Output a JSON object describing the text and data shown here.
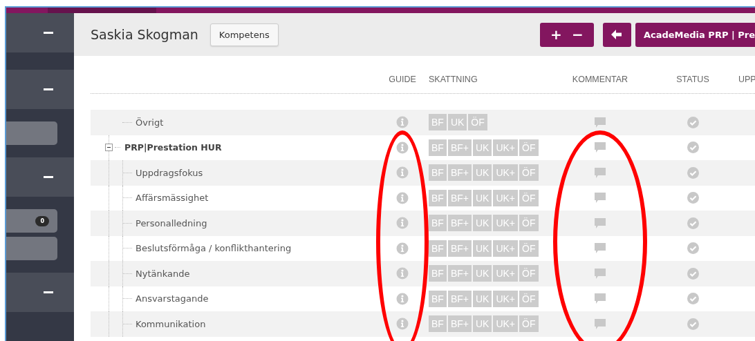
{
  "header": {
    "title": "Saskia Skogman",
    "tab_button": "Kompetens"
  },
  "toolbar": [
    {
      "kind": "group",
      "labels": [
        "+",
        "−"
      ]
    },
    {
      "kind": "back"
    },
    {
      "kind": "menu",
      "label": "AcadeMedia PRP | Pre"
    }
  ],
  "sidebar": {
    "items": [
      {
        "kind": "section"
      },
      {
        "kind": "section"
      },
      {
        "kind": "pills",
        "pills": [
          {
            "kind": "plain"
          }
        ]
      },
      {
        "kind": "section"
      },
      {
        "kind": "pills",
        "pills": [
          {
            "kind": "badge",
            "badge": "0"
          },
          {
            "kind": "plain"
          }
        ]
      },
      {
        "kind": "section"
      }
    ]
  },
  "table": {
    "columns": [
      {
        "label": "GUIDE",
        "circled": true
      },
      {
        "label": "SKATTNING",
        "circled": false
      },
      {
        "label": "KOMMENTAR",
        "circled": true
      },
      {
        "label": "STATUS",
        "circled": false
      },
      {
        "label": "UPP",
        "circled": false
      }
    ],
    "rows": [
      {
        "kind": "item",
        "name": "Övrigt",
        "grades": [
          "BF",
          "UK",
          "ÖF"
        ]
      },
      {
        "kind": "group",
        "name": "PRP|Prestation HUR",
        "expanded": true,
        "grades": [
          "BF",
          "BF+",
          "UK",
          "UK+",
          "ÖF"
        ]
      },
      {
        "kind": "item",
        "name": "Uppdragsfokus",
        "grades": [
          "BF",
          "BF+",
          "UK",
          "UK+",
          "ÖF"
        ]
      },
      {
        "kind": "item",
        "name": "Affärsmässighet",
        "grades": [
          "BF",
          "BF+",
          "UK",
          "UK+",
          "ÖF"
        ]
      },
      {
        "kind": "item",
        "name": "Personalledning",
        "grades": [
          "BF",
          "BF+",
          "UK",
          "UK+",
          "ÖF"
        ]
      },
      {
        "kind": "item",
        "name": "Beslutsförmåga / konflikthantering",
        "grades": [
          "BF",
          "BF+",
          "UK",
          "UK+",
          "ÖF"
        ]
      },
      {
        "kind": "item",
        "name": "Nytänkande",
        "grades": [
          "BF",
          "BF+",
          "UK",
          "UK+",
          "ÖF"
        ]
      },
      {
        "kind": "item",
        "name": "Ansvarstagande",
        "grades": [
          "BF",
          "BF+",
          "UK",
          "UK+",
          "ÖF"
        ]
      },
      {
        "kind": "item",
        "name": "Kommunikation",
        "grades": [
          "BF",
          "BF+",
          "UK",
          "UK+",
          "ÖF"
        ]
      }
    ]
  }
}
